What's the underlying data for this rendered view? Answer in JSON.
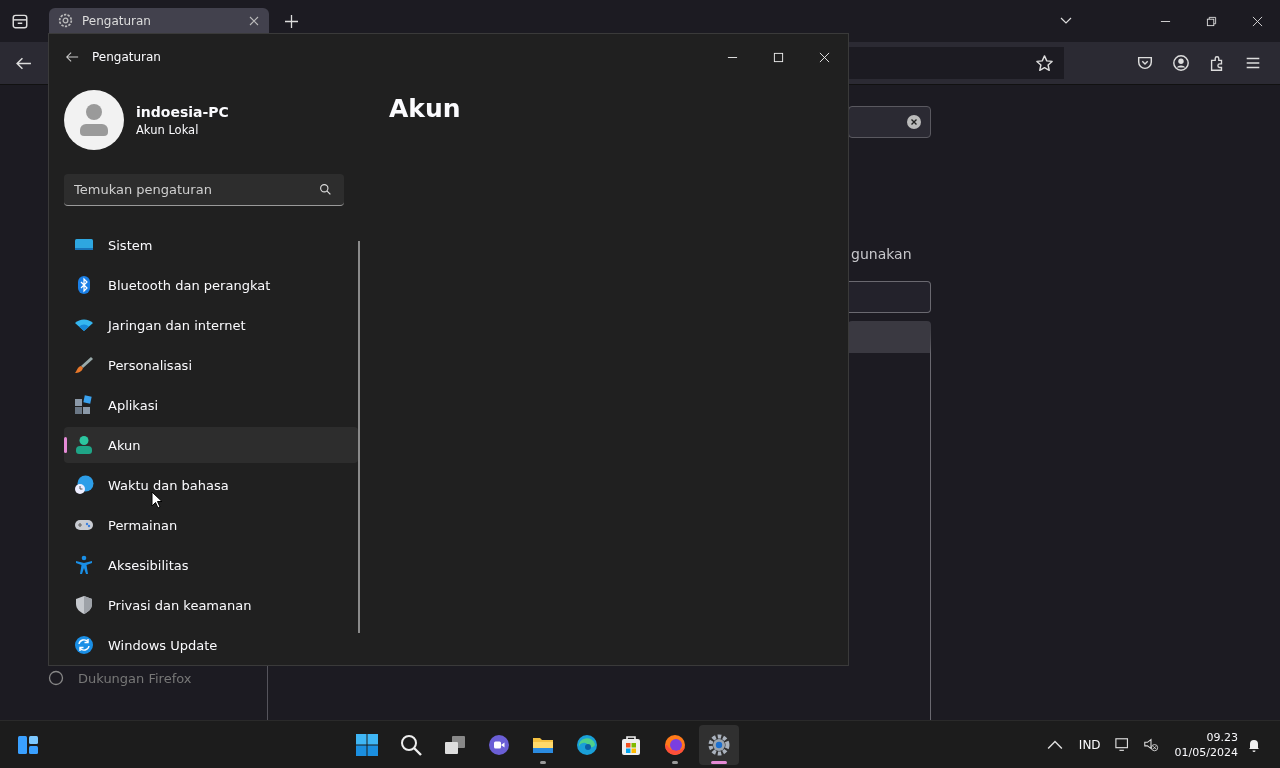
{
  "browser": {
    "tabs": [
      {
        "label": "Pengaturan",
        "selected": true
      }
    ],
    "sidebar_items": [
      {
        "label": "Dukungan Firefox"
      }
    ],
    "content_text": "gunakan"
  },
  "settings_window": {
    "title": "Pengaturan",
    "user": {
      "name": "indoesia-PC",
      "account_type": "Akun Lokal"
    },
    "search": {
      "placeholder": "Temukan pengaturan"
    },
    "nav": [
      {
        "label": "Sistem",
        "kind": "system",
        "selected": false
      },
      {
        "label": "Bluetooth dan perangkat",
        "kind": "bluetooth",
        "selected": false
      },
      {
        "label": "Jaringan dan internet",
        "kind": "network",
        "selected": false
      },
      {
        "label": "Personalisasi",
        "kind": "brush",
        "selected": false
      },
      {
        "label": "Aplikasi",
        "kind": "apps",
        "selected": false
      },
      {
        "label": "Akun",
        "kind": "account",
        "selected": true
      },
      {
        "label": "Waktu dan bahasa",
        "kind": "time",
        "selected": false
      },
      {
        "label": "Permainan",
        "kind": "gaming",
        "selected": false
      },
      {
        "label": "Aksesibilitas",
        "kind": "accessibility",
        "selected": false
      },
      {
        "label": "Privasi dan keamanan",
        "kind": "privacy",
        "selected": false
      },
      {
        "label": "Windows Update",
        "kind": "update",
        "selected": false
      }
    ],
    "page_title": "Akun"
  },
  "taskbar": {
    "apps": [
      {
        "kind": "start",
        "running": false,
        "selected": false
      },
      {
        "kind": "search",
        "running": false,
        "selected": false
      },
      {
        "kind": "taskview",
        "running": false,
        "selected": false
      },
      {
        "kind": "chat",
        "running": false,
        "selected": false
      },
      {
        "kind": "files",
        "running": true,
        "selected": false
      },
      {
        "kind": "edge",
        "running": false,
        "selected": false
      },
      {
        "kind": "store",
        "running": false,
        "selected": false
      },
      {
        "kind": "firefox",
        "running": true,
        "selected": false
      },
      {
        "kind": "settings",
        "running": true,
        "selected": true
      }
    ],
    "language": "IND",
    "time": "09.23",
    "date": "01/05/2024"
  }
}
